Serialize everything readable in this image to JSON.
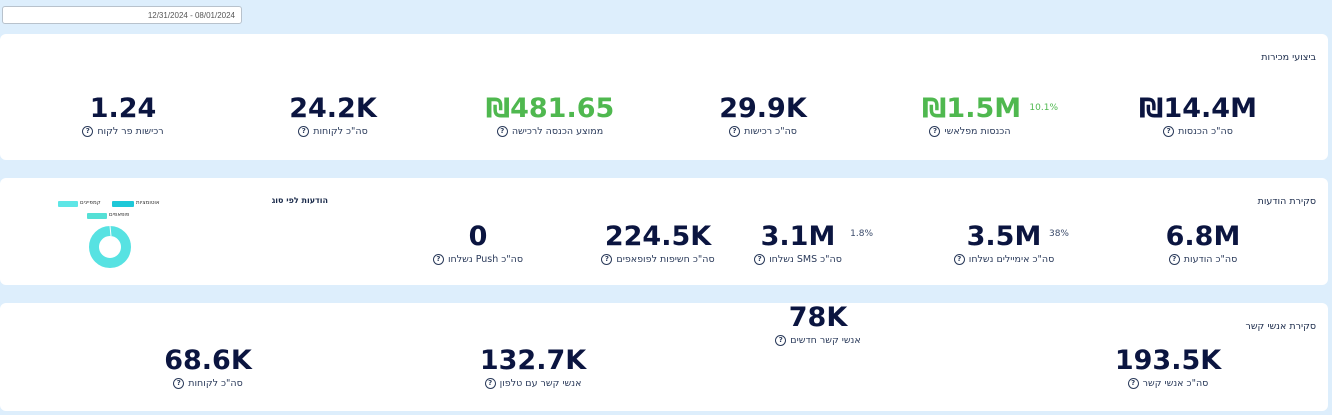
{
  "date_range": {
    "value": "12/31/2024 - 08/01/2024"
  },
  "sales": {
    "title": "ביצועי מכירות",
    "metrics": [
      {
        "value": "₪14.4M",
        "label": "סה\"כ הכנסות",
        "color": "default"
      },
      {
        "value": "₪1.5M",
        "label": "הכנסות מפלאשי",
        "color": "green",
        "pct": "10.1%"
      },
      {
        "value": "29.9K",
        "label": "סה\"כ רכישות",
        "color": "default"
      },
      {
        "value": "₪481.65",
        "label": "ממוצע הכנסה לרכישה",
        "color": "green"
      },
      {
        "value": "24.2K",
        "label": "סה\"כ לקוחות",
        "color": "default"
      },
      {
        "value": "1.24",
        "label": "רכישות פר לקוח",
        "color": "default"
      }
    ]
  },
  "messages": {
    "title": "סקירת הודעות",
    "metrics": [
      {
        "value": "6.8M",
        "label": "סה\"כ הודעות"
      },
      {
        "value": "3.5M",
        "label": "סה\"כ אימיילים נשלחו",
        "pct": "38%"
      },
      {
        "value": "3.1M",
        "label": "סה\"כ SMS נשלחו",
        "pct": "1.8%"
      },
      {
        "value": "224.5K",
        "label": "סה\"כ חשיפות לפופאפים"
      },
      {
        "value": "0",
        "label": "סה\"כ Push נשלחו"
      }
    ],
    "chart": {
      "title": "הודעות לפי סוג",
      "legend": [
        "אוטומציות",
        "קמפיינים",
        "פופאפים"
      ],
      "colors": {
        "automations": "#1ec8d8",
        "campaigns": "#5ee6e6",
        "popups": "#55e0d6",
        "donut": "#57e2e2"
      }
    }
  },
  "contacts": {
    "title": "סקירת אנשי קשר",
    "metrics": [
      {
        "value": "193.5K",
        "label": "סה\"כ אנשי קשר"
      },
      {
        "value": "78K",
        "label": "אנשי קשר חדשים"
      },
      {
        "value": "132.7K",
        "label": "אנשי קשר עם טלפון"
      },
      {
        "value": "68.6K",
        "label": "סה\"כ לקוחות"
      }
    ]
  },
  "icons": {
    "help": "question-circle-icon"
  }
}
